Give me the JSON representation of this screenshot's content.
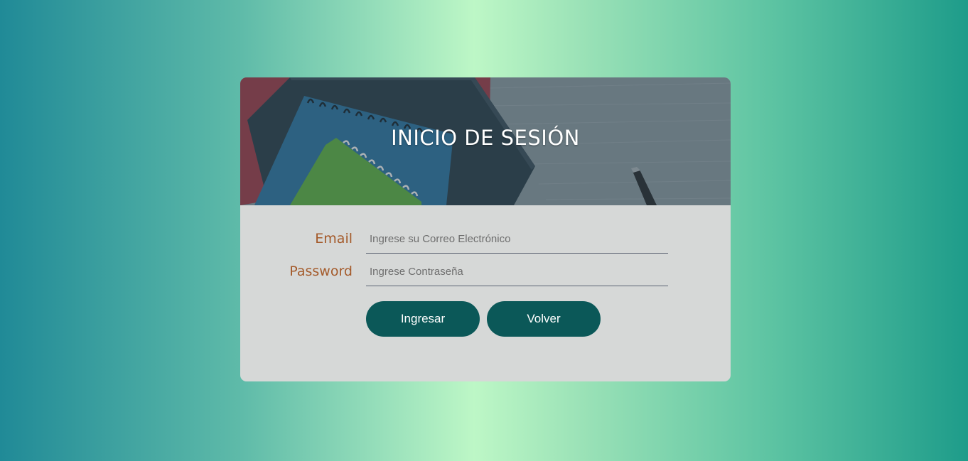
{
  "login": {
    "title": "INICIO DE SESIÓN",
    "email_label": "Email",
    "email_placeholder": "Ingrese su Correo Electrónico",
    "password_label": "Password",
    "password_placeholder": "Ingrese Contraseña",
    "submit_label": "Ingresar",
    "back_label": "Volver"
  },
  "colors": {
    "button": "#0b5858",
    "label": "#a45a2a",
    "card": "#d6d8d7"
  },
  "icons": {
    "banner": "notebooks-desk-photo"
  }
}
